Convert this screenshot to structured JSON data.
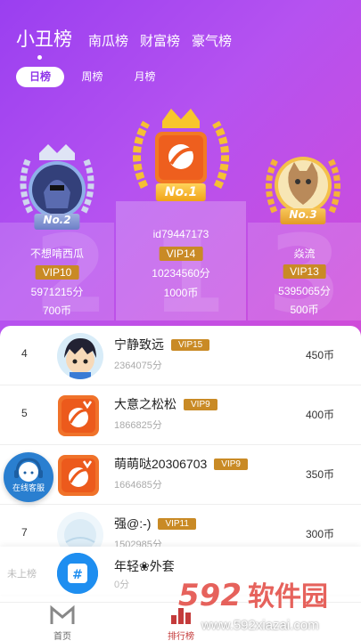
{
  "header": {
    "tabs": [
      {
        "label": "小丑榜",
        "active": true
      },
      {
        "label": "南瓜榜",
        "active": false
      },
      {
        "label": "财富榜",
        "active": false
      },
      {
        "label": "豪气榜",
        "active": false
      }
    ],
    "periods": [
      {
        "label": "日榜",
        "active": true
      },
      {
        "label": "周榜",
        "active": false
      },
      {
        "label": "月榜",
        "active": false
      }
    ]
  },
  "podium": {
    "first": {
      "badge": "No.1",
      "name": "id79447173",
      "vip": "VIP14",
      "score": "10234560分",
      "coins": "1000币"
    },
    "second": {
      "badge": "No.2",
      "name": "不想啃西瓜",
      "vip": "VIP10",
      "score": "5971215分",
      "coins": "700币"
    },
    "third": {
      "badge": "No.3",
      "name": "焱流",
      "vip": "VIP13",
      "score": "5395065分",
      "coins": "500币"
    },
    "bg_numbers": [
      "2",
      "1",
      "3"
    ]
  },
  "list": [
    {
      "rank": "4",
      "name": "宁静致远",
      "vip": "VIP15",
      "score": "2364075分",
      "coins": "450币",
      "avatar": "cartoon-boy-avatar"
    },
    {
      "rank": "5",
      "name": "大意之松松",
      "vip": "VIP9",
      "score": "1866825分",
      "coins": "400币",
      "avatar": "app-logo-avatar"
    },
    {
      "rank": "6",
      "name": "萌萌哒20306703",
      "vip": "VIP9",
      "score": "1664685分",
      "coins": "350币",
      "avatar": "app-logo-avatar"
    },
    {
      "rank": "7",
      "name": "强@:-)",
      "vip": "VIP11",
      "score": "1502985分",
      "coins": "300币",
      "avatar": "light-circle-avatar"
    }
  ],
  "me": {
    "rank": "未上榜",
    "name": "年轻❀外套",
    "score": "0分"
  },
  "service": {
    "label": "在线客服"
  },
  "bottom_nav": [
    {
      "label": "首页",
      "icon": "home-m-icon"
    },
    {
      "label": "排行榜",
      "icon": "rank-icon"
    }
  ],
  "watermark": {
    "brand": "592软件园",
    "url": "www.592xiazai.com"
  },
  "colors": {
    "accent": "#9a3ff0",
    "vip": "#c98a25",
    "gold": "#f2b21b"
  }
}
